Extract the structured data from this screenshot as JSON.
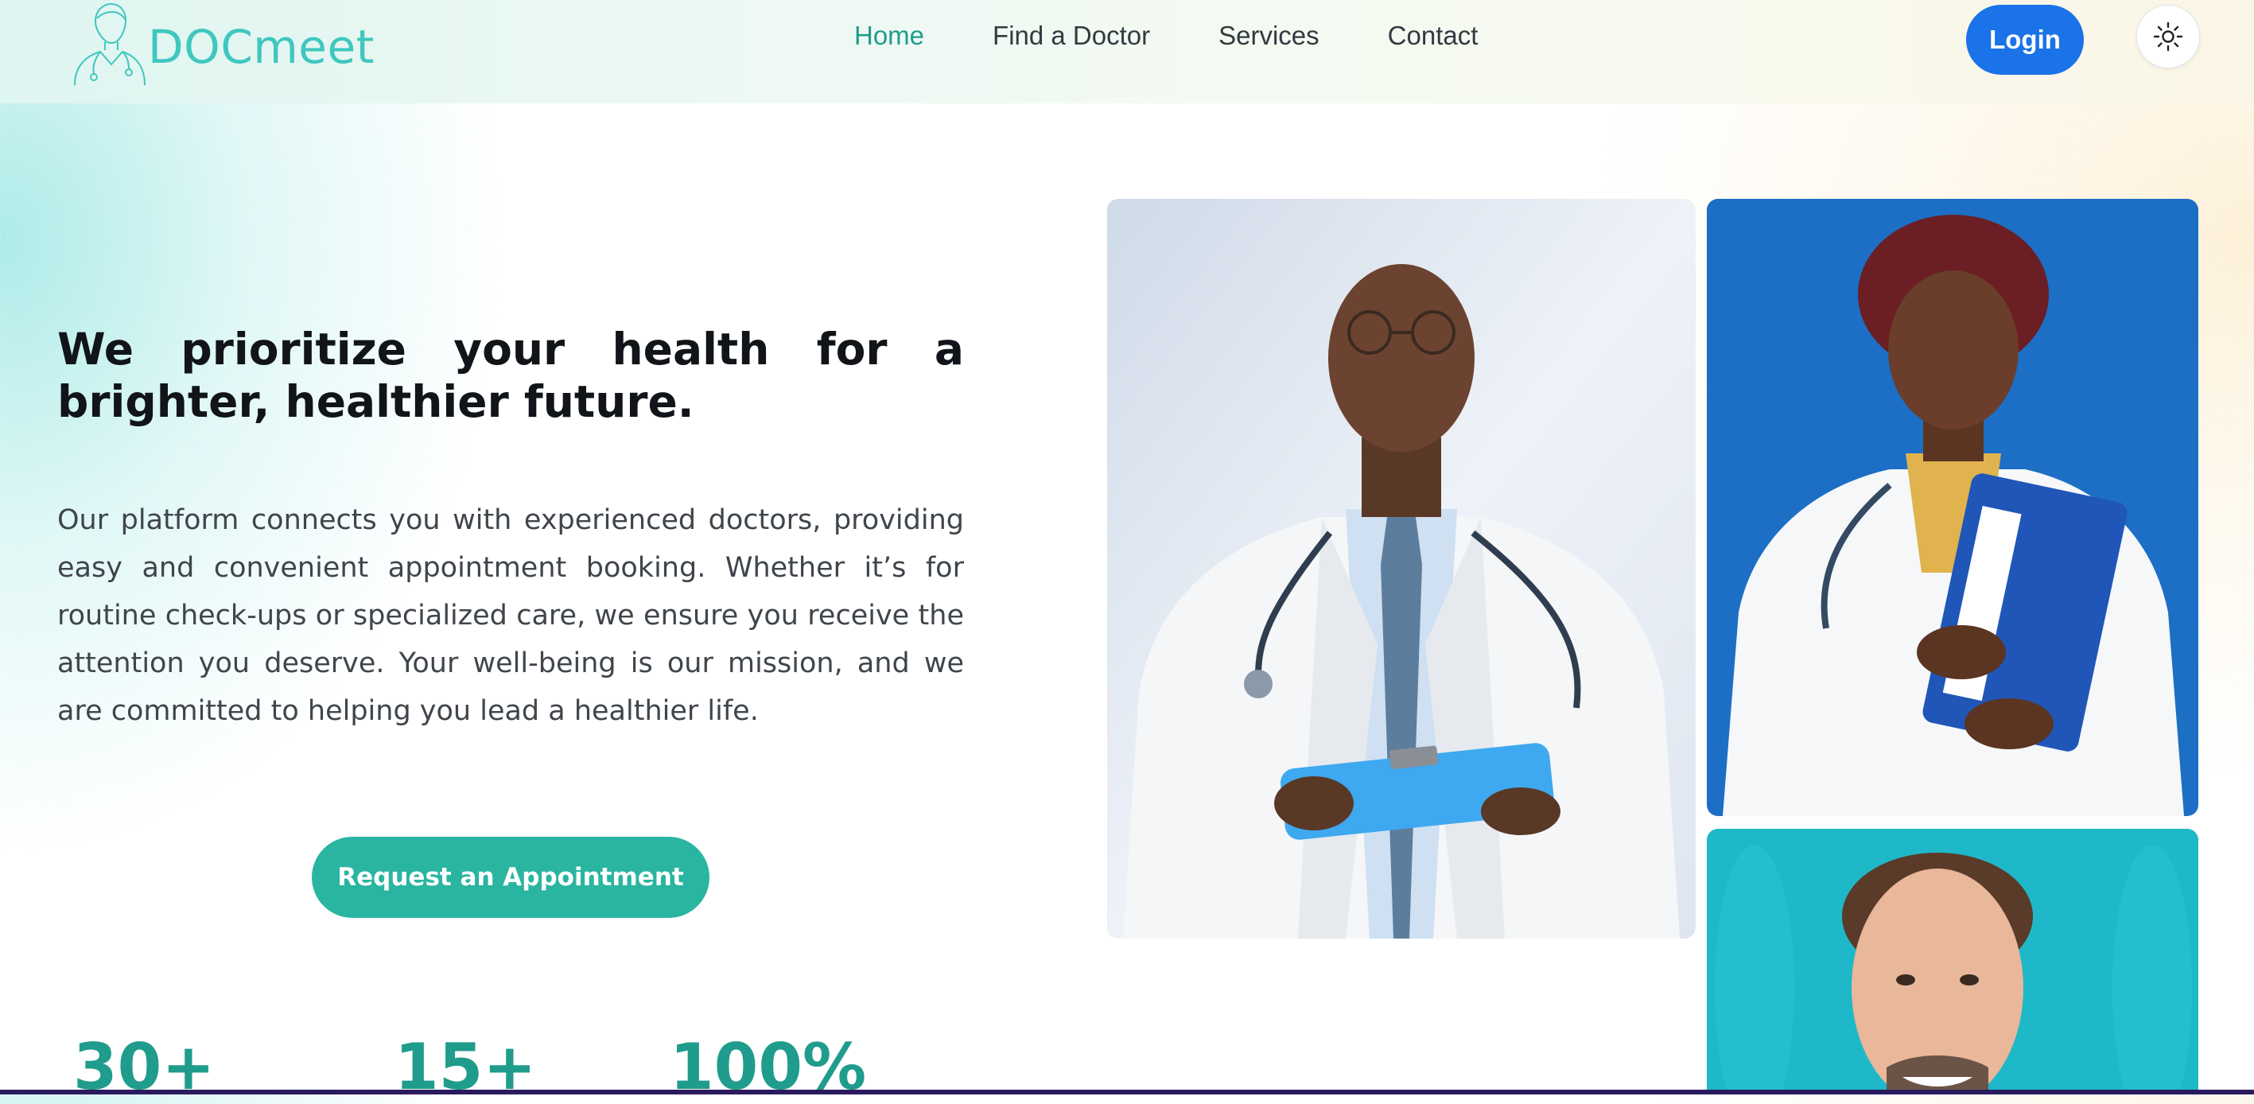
{
  "brand": {
    "name": "DOCmeet",
    "logo_icon": "doctor-outline-icon",
    "color": "#3fc7bf"
  },
  "nav": {
    "items": [
      {
        "label": "Home",
        "active": true
      },
      {
        "label": "Find a Doctor",
        "active": false
      },
      {
        "label": "Services",
        "active": false
      },
      {
        "label": "Contact",
        "active": false
      }
    ]
  },
  "header_actions": {
    "login_label": "Login",
    "theme_toggle_icon": "sun-icon"
  },
  "hero": {
    "title": "We prioritize your health for a brighter, healthier future.",
    "description": "Our platform connects you with experienced doctors, providing easy and convenient appointment booking. Whether it’s for routine check-ups or specialized care, we ensure you receive the attention you deserve. Your well-being is our mission, and we are committed to helping you lead a healthier life.",
    "cta_label": "Request an Appointment"
  },
  "stats": [
    {
      "value": "30+"
    },
    {
      "value": "15+"
    },
    {
      "value": "100%"
    }
  ],
  "photos": [
    {
      "subject": "male doctor with clipboard",
      "background": "#e8eef6"
    },
    {
      "subject": "female doctor with blue folder",
      "background": "#1c6fc4"
    },
    {
      "subject": "male doctor smiling",
      "background": "#1fb8c8"
    }
  ],
  "colors": {
    "accent": "#2ab5a1",
    "nav_active": "#1f9c8c",
    "login": "#1a73e8"
  }
}
